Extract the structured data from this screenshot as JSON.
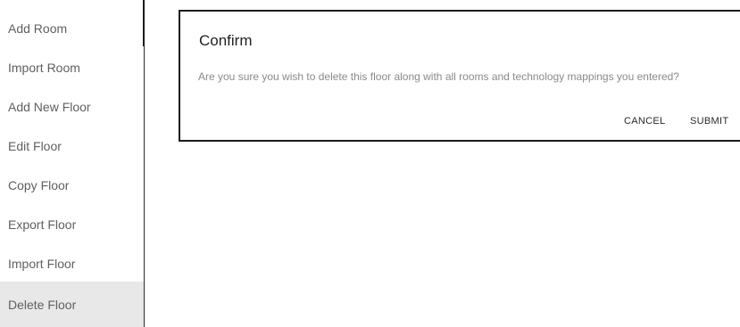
{
  "menu": {
    "items": [
      {
        "label": "Add Room"
      },
      {
        "label": "Import Room"
      },
      {
        "label": "Add New Floor"
      },
      {
        "label": "Edit Floor"
      },
      {
        "label": "Copy Floor"
      },
      {
        "label": "Export Floor"
      },
      {
        "label": "Import Floor"
      },
      {
        "label": "Delete Floor",
        "selected": true
      }
    ],
    "selected_background": "#e8e8e8"
  },
  "dialog": {
    "title": "Confirm",
    "message": "Are you sure you wish to delete this floor along with all rooms and technology mappings you entered?",
    "cancel_label": "CANCEL",
    "submit_label": "SUBMIT"
  }
}
